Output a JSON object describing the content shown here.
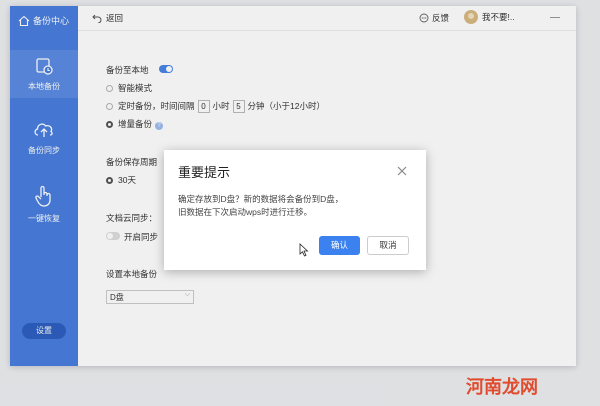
{
  "sidebar": {
    "brand": "备份中心",
    "items": [
      {
        "label": "本地备份",
        "icon": "local-backup-icon"
      },
      {
        "label": "备份同步",
        "icon": "cloud-upload-icon"
      },
      {
        "label": "一键恢复",
        "icon": "hand-pointer-icon"
      }
    ],
    "settings_label": "设置"
  },
  "topbar": {
    "back_label": "返回",
    "feedback_label": "反馈",
    "user_label": "我不要!.."
  },
  "content": {
    "backup_local_label": "备份至本地",
    "backup_local_enabled": true,
    "mode_options": {
      "smart": "智能模式",
      "timed_prefix": "定时备份，时间间隔",
      "timed_hours": "0",
      "timed_hours_unit": "小时",
      "timed_minutes": "5",
      "timed_minutes_unit": "分钟（小于12小时）",
      "incremental": "增量备份"
    },
    "selected_mode": "incremental",
    "retention_label": "备份保存周期",
    "retention_option": "30天",
    "doc_sync_label": "文档云同步：",
    "doc_sync_toggle_label": "开启同步",
    "doc_sync_enabled": false,
    "backup_location_label": "设置本地备份",
    "location_value": "D盘"
  },
  "dialog": {
    "title": "重要提示",
    "message_line1": "确定存放到D盘？新的数据将会备份到D盘，",
    "message_line2": "旧数据在下次启动wps时进行迁移。",
    "ok_label": "确认",
    "cancel_label": "取消"
  },
  "watermark": "河南龙网",
  "colors": {
    "sidebar": "#4a7fe0",
    "primary_button": "#3b82f0",
    "watermark": "#e14b2e"
  }
}
